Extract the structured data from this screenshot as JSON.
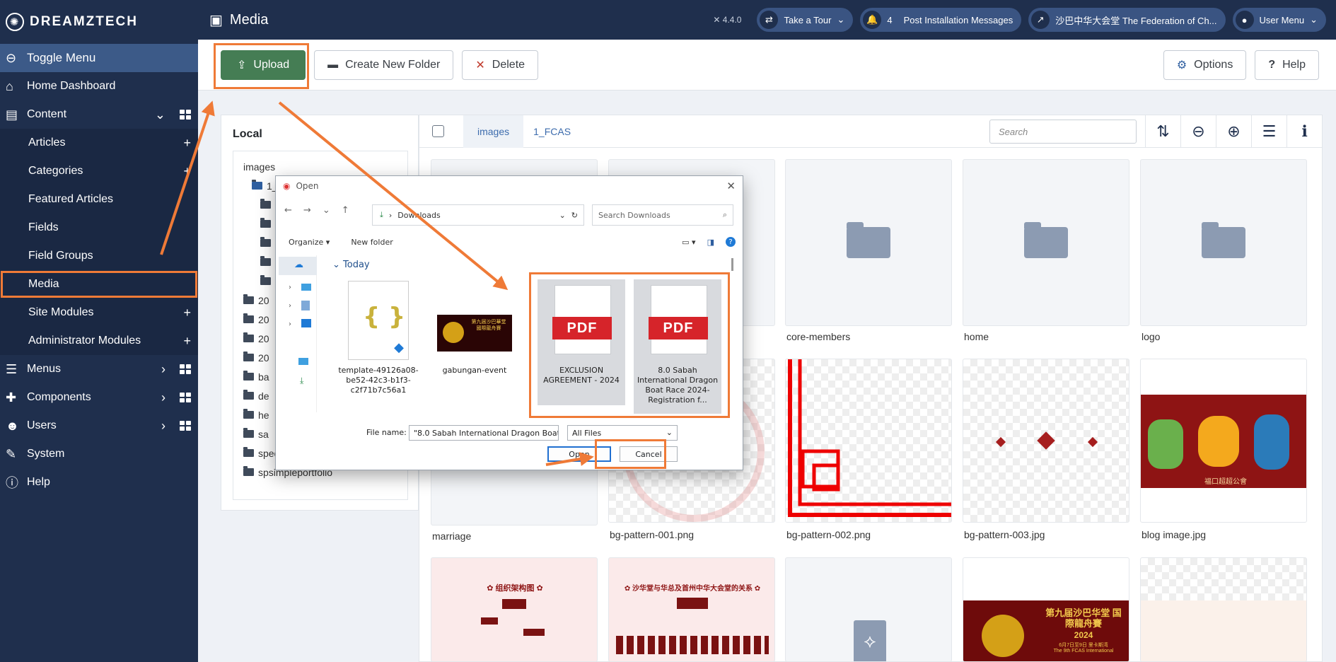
{
  "brand": "DREAMZTECH",
  "header": {
    "title": "Media",
    "version": "4.4.0",
    "tour": "Take a Tour",
    "messages_count": "4",
    "messages": "Post Installation Messages",
    "site": "沙巴中华大会堂 The Federation of Ch...",
    "user_menu": "User Menu"
  },
  "sidebar": {
    "toggle": "Toggle Menu",
    "items": [
      {
        "label": "Home Dashboard"
      },
      {
        "label": "Content"
      },
      {
        "label": "Articles"
      },
      {
        "label": "Categories"
      },
      {
        "label": "Featured Articles"
      },
      {
        "label": "Fields"
      },
      {
        "label": "Field Groups"
      },
      {
        "label": "Media"
      },
      {
        "label": "Site Modules"
      },
      {
        "label": "Administrator Modules"
      },
      {
        "label": "Menus"
      },
      {
        "label": "Components"
      },
      {
        "label": "Users"
      },
      {
        "label": "System"
      },
      {
        "label": "Help"
      }
    ]
  },
  "toolbar": {
    "upload": "Upload",
    "create_folder": "Create New Folder",
    "delete": "Delete",
    "options": "Options",
    "help": "Help"
  },
  "tree": {
    "title": "Local",
    "root": "images",
    "nodes": [
      "1_",
      "20",
      "20",
      "20",
      "20",
      "ba",
      "de",
      "he",
      "sa",
      "spedsyimagegallery",
      "spsimpleportfolio"
    ]
  },
  "browser": {
    "crumbs": [
      "images",
      "1_FCAS"
    ],
    "search_placeholder": "Search",
    "tiles": [
      {
        "label": "core-members"
      },
      {
        "label": "home"
      },
      {
        "label": "logo"
      },
      {
        "label": "marriage"
      },
      {
        "label": "bg-pattern-001.png"
      },
      {
        "label": "bg-pattern-002.png"
      },
      {
        "label": "bg-pattern-003.jpg"
      },
      {
        "label": "blog image.jpg"
      }
    ],
    "thumb_texts": {
      "org_chart": "组织架构图",
      "relation": "沙华堂与华总及首州中华大会堂的关系",
      "race_title": "第九届沙巴华堂 国際龍舟賽",
      "race_year": "2024",
      "race_date": "6月7日至9日 里卡斯湾",
      "race_en": "The 9th FCAS International",
      "blog_text": "福口超超公會"
    }
  },
  "dialog": {
    "title": "Open",
    "location": "Downloads",
    "search_placeholder": "Search Downloads",
    "organize": "Organize",
    "new_folder": "New folder",
    "section": "Today",
    "files": [
      {
        "label": "template-49126a08-be52-42c3-b1f3-c2f71b7c56a1"
      },
      {
        "label": "gabungan-event"
      },
      {
        "label": "EXCLUSION AGREEMENT - 2024"
      },
      {
        "label": "8.0 Sabah International Dragon Boat Race 2024-Registration f..."
      }
    ],
    "event_thumb_text": "第九届沙巴華堂 國際龍舟賽",
    "pdf_badge": "PDF",
    "file_name_label": "File name:",
    "file_name_value": "\"8.0 Sabah International Dragon Boat Race 2",
    "file_type": "All Files",
    "open": "Open",
    "cancel": "Cancel"
  }
}
